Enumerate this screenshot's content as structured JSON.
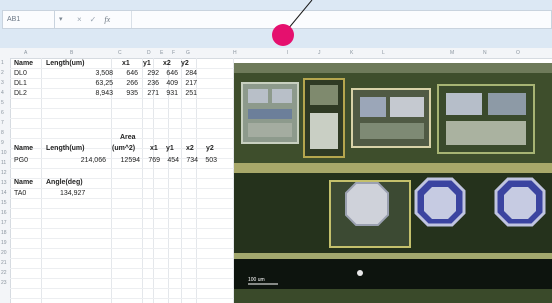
{
  "formula_bar": {
    "name_box": "AB1",
    "fx_label": "fx",
    "cancel_icon": "×",
    "enter_icon": "✓",
    "value": ""
  },
  "columns": [
    "A",
    "B",
    "C",
    "D",
    "E",
    "F",
    "G",
    "H",
    "I",
    "J",
    "K",
    "L",
    "M",
    "N",
    "O"
  ],
  "rows": [
    "1",
    "2",
    "3",
    "4",
    "5",
    "6",
    "7",
    "8",
    "9",
    "10",
    "11",
    "12",
    "13",
    "14",
    "15",
    "16",
    "17",
    "18",
    "19",
    "20",
    "21",
    "22",
    "23"
  ],
  "table1": {
    "headers": [
      "Name",
      "Length(um)",
      "x1",
      "y1",
      "x2",
      "y2"
    ],
    "rows": [
      [
        "DL0",
        "3,508",
        "646",
        "292",
        "646",
        "284"
      ],
      [
        "DL1",
        "63,25",
        "266",
        "236",
        "409",
        "217"
      ],
      [
        "DL2",
        "8,943",
        "935",
        "271",
        "931",
        "251"
      ]
    ]
  },
  "table2": {
    "area_label": "Area",
    "headers": [
      "Name",
      "Length(um)",
      "(um^2)",
      "x1",
      "y1",
      "x2",
      "y2"
    ],
    "rows": [
      [
        "PG0",
        "214,066",
        "12594",
        "769",
        "454",
        "734",
        "503"
      ]
    ]
  },
  "table3": {
    "headers": [
      "Name",
      "Angle(deg)"
    ],
    "rows": [
      [
        "TA0",
        "134,927"
      ]
    ]
  },
  "image": {
    "scale_label": "100 um"
  },
  "colors": {
    "pointer": "#e5106e",
    "ribbon": "#dce8f4"
  }
}
